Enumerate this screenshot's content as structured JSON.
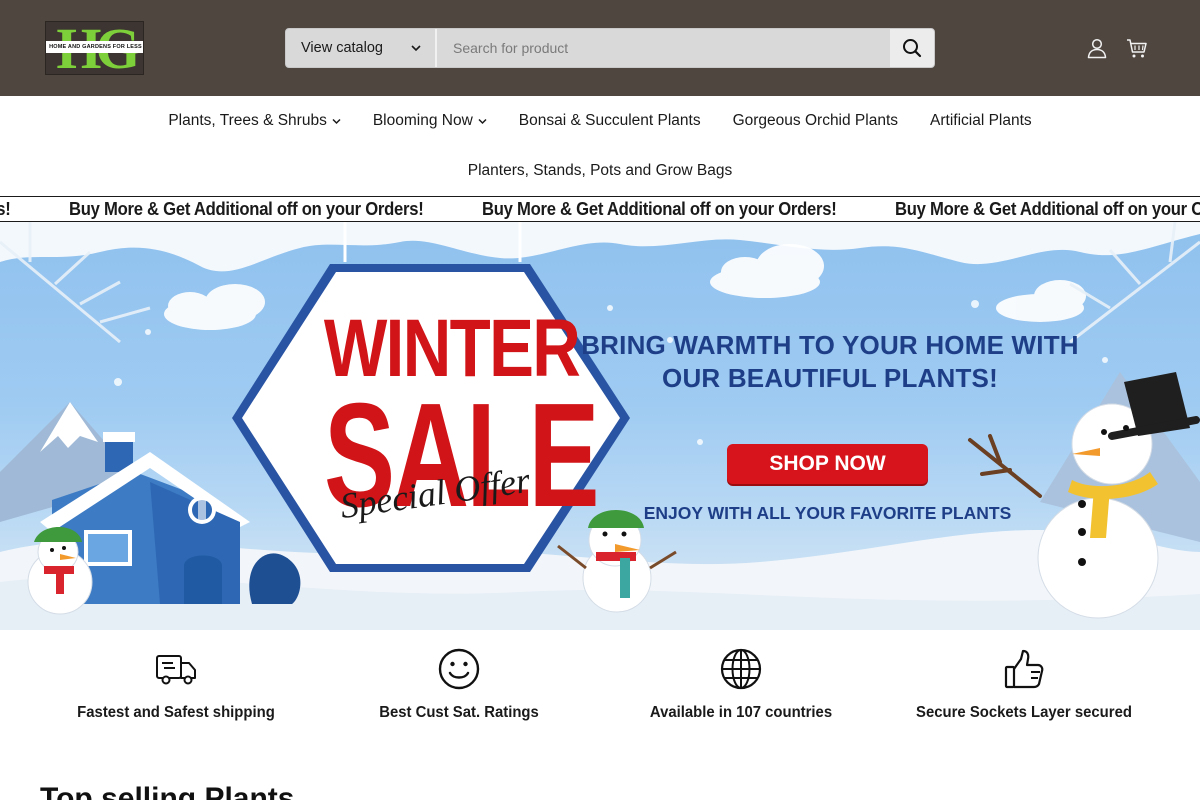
{
  "header": {
    "logo_letters": "HG",
    "logo_tagline": "HOME AND GARDENS FOR LESS",
    "catalog_label": "View catalog",
    "search_placeholder": "Search for product",
    "icons": [
      "search-icon",
      "account-icon",
      "cart-icon"
    ],
    "background_color": "#4f4640"
  },
  "nav": {
    "row1": [
      {
        "label": "Plants, Trees & Shrubs",
        "has_dropdown": true
      },
      {
        "label": "Blooming Now",
        "has_dropdown": true
      },
      {
        "label": "Bonsai & Succulent Plants",
        "has_dropdown": false
      },
      {
        "label": "Gorgeous Orchid Plants",
        "has_dropdown": false
      },
      {
        "label": "Artificial Plants",
        "has_dropdown": false
      }
    ],
    "row2": [
      {
        "label": "Planters, Stands, Pots and Grow Bags",
        "has_dropdown": false
      }
    ]
  },
  "marquee": {
    "text": "Buy More & Get Additional off on your Orders!"
  },
  "banner": {
    "headline_1": "WINTER",
    "headline_2": "SALE",
    "script": "Special Offer",
    "tagline": "BRING WARMTH TO YOUR HOME WITH OUR BEAUTIFUL PLANTS!",
    "cta": "SHOP NOW",
    "subtext": "ENJOY WITH ALL YOUR FAVORITE PLANTS",
    "accent_red": "#d7141b",
    "text_blue": "#1e3f88"
  },
  "features": [
    {
      "label": "Fastest and Safest shipping",
      "icon": "truck-icon"
    },
    {
      "label": "Best Cust Sat. Ratings",
      "icon": "smiley-icon"
    },
    {
      "label": "Available in 107 countries",
      "icon": "globe-icon"
    },
    {
      "label": "Secure Sockets Layer secured",
      "icon": "thumbs-up-icon"
    }
  ],
  "section": {
    "title": "Top selling Plants"
  }
}
